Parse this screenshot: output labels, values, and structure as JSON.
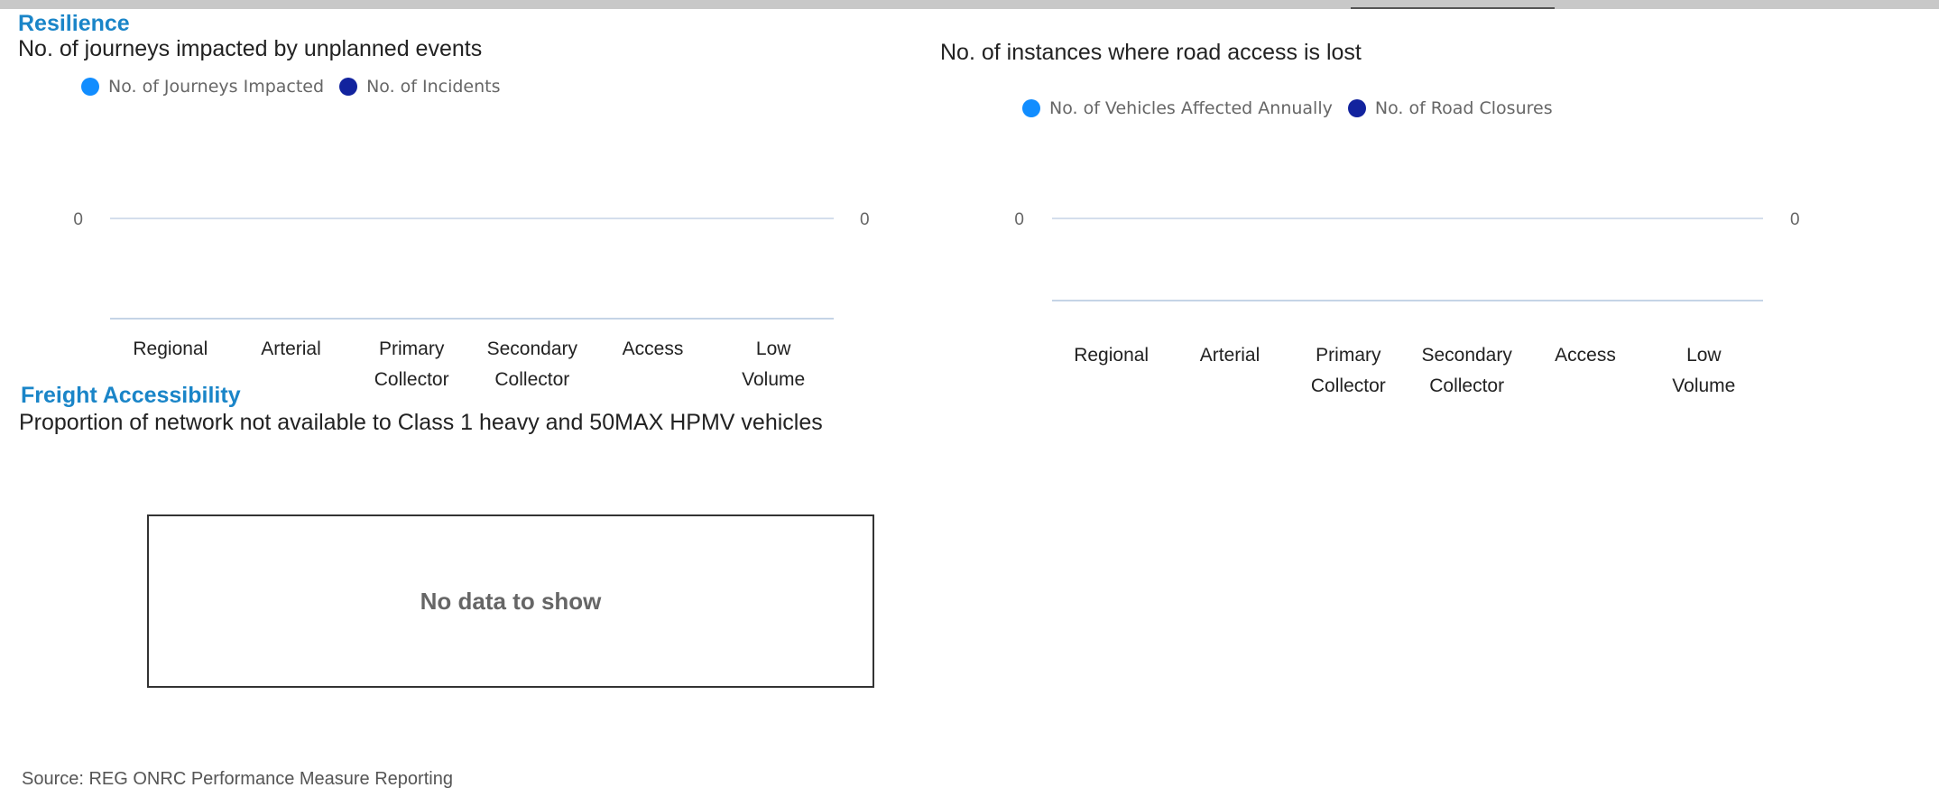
{
  "colors": {
    "section": "#1a85c8",
    "series_light": "#118dff",
    "series_dark": "#12239e",
    "axis": "#c5d4e6"
  },
  "resilience": {
    "section_title": "Resilience",
    "chart_title": "No. of journeys impacted by unplanned events"
  },
  "road_access": {
    "chart_title": "No. of instances where road access is lost"
  },
  "freight": {
    "section_title": "Freight Accessibility",
    "chart_title": "Proportion of network not available to Class 1 heavy and 50MAX HPMV vehicles",
    "no_data": "No data to show"
  },
  "source": "Source: REG ONRC Performance Measure Reporting",
  "chart_data": [
    {
      "type": "bar",
      "title": "No. of journeys impacted by unplanned events",
      "categories": [
        "Regional",
        "Arterial",
        "Primary Collector",
        "Secondary Collector",
        "Access",
        "Low Volume"
      ],
      "category_lines": [
        [
          "Regional"
        ],
        [
          "Arterial"
        ],
        [
          "Primary",
          "Collector"
        ],
        [
          "Secondary",
          "Collector"
        ],
        [
          "Access"
        ],
        [
          "Low",
          "Volume"
        ]
      ],
      "series": [
        {
          "name": "No. of Journeys Impacted",
          "values": [
            0,
            0,
            0,
            0,
            0,
            0
          ]
        },
        {
          "name": "No. of Incidents",
          "values": [
            0,
            0,
            0,
            0,
            0,
            0
          ]
        }
      ],
      "y_ticks_left": [
        "0"
      ],
      "y_ticks_right": [
        "0"
      ],
      "legend": "top-left",
      "grid": true
    },
    {
      "type": "bar",
      "title": "No. of instances where road access is lost",
      "categories": [
        "Regional",
        "Arterial",
        "Primary Collector",
        "Secondary Collector",
        "Access",
        "Low Volume"
      ],
      "category_lines": [
        [
          "Regional"
        ],
        [
          "Arterial"
        ],
        [
          "Primary",
          "Collector"
        ],
        [
          "Secondary",
          "Collector"
        ],
        [
          "Access"
        ],
        [
          "Low",
          "Volume"
        ]
      ],
      "series": [
        {
          "name": "No. of Vehicles Affected Annually",
          "values": [
            0,
            0,
            0,
            0,
            0,
            0
          ]
        },
        {
          "name": "No. of Road Closures",
          "values": [
            0,
            0,
            0,
            0,
            0,
            0
          ]
        }
      ],
      "y_ticks_left": [
        "0"
      ],
      "y_ticks_right": [
        "0"
      ],
      "legend": "top-left",
      "grid": true
    }
  ]
}
